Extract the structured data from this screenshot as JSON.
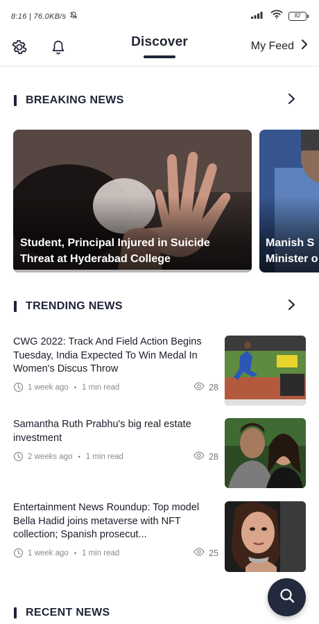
{
  "status_bar": {
    "left_text": "8:16 | 76.0KB/s",
    "battery": "82"
  },
  "top_nav": {
    "title": "Discover",
    "my_feed_label": "My Feed"
  },
  "breaking": {
    "title": "BREAKING NEWS",
    "cards": [
      {
        "headline": "Student, Principal Injured in Suicide Threat at Hyderabad College"
      },
      {
        "headline": "Manish S",
        "headline_line2": "Minister o"
      }
    ]
  },
  "trending": {
    "title": "TRENDING NEWS",
    "items": [
      {
        "headline": "CWG 2022: Track And Field Action Begins Tuesday, India Expected To Win Medal In Women's Discus Throw",
        "time": "1 week ago",
        "read": "1 min read",
        "views": "28"
      },
      {
        "headline": "Samantha Ruth Prabhu's big real estate investment",
        "time": "2 weeks ago",
        "read": "1 min read",
        "views": "28"
      },
      {
        "headline": "Entertainment News Roundup: Top model Bella Hadid joins metaverse with NFT collection; Spanish prosecut...",
        "time": "1 week ago",
        "read": "1 min read",
        "views": "25"
      }
    ]
  },
  "recent": {
    "title": "RECENT NEWS"
  },
  "colors": {
    "accent": "#1f2337",
    "meta_text": "#8a8a8f"
  },
  "icons": [
    "gear-icon",
    "bell-icon",
    "chevron-right-icon",
    "clock-icon",
    "eye-icon",
    "search-icon"
  ]
}
